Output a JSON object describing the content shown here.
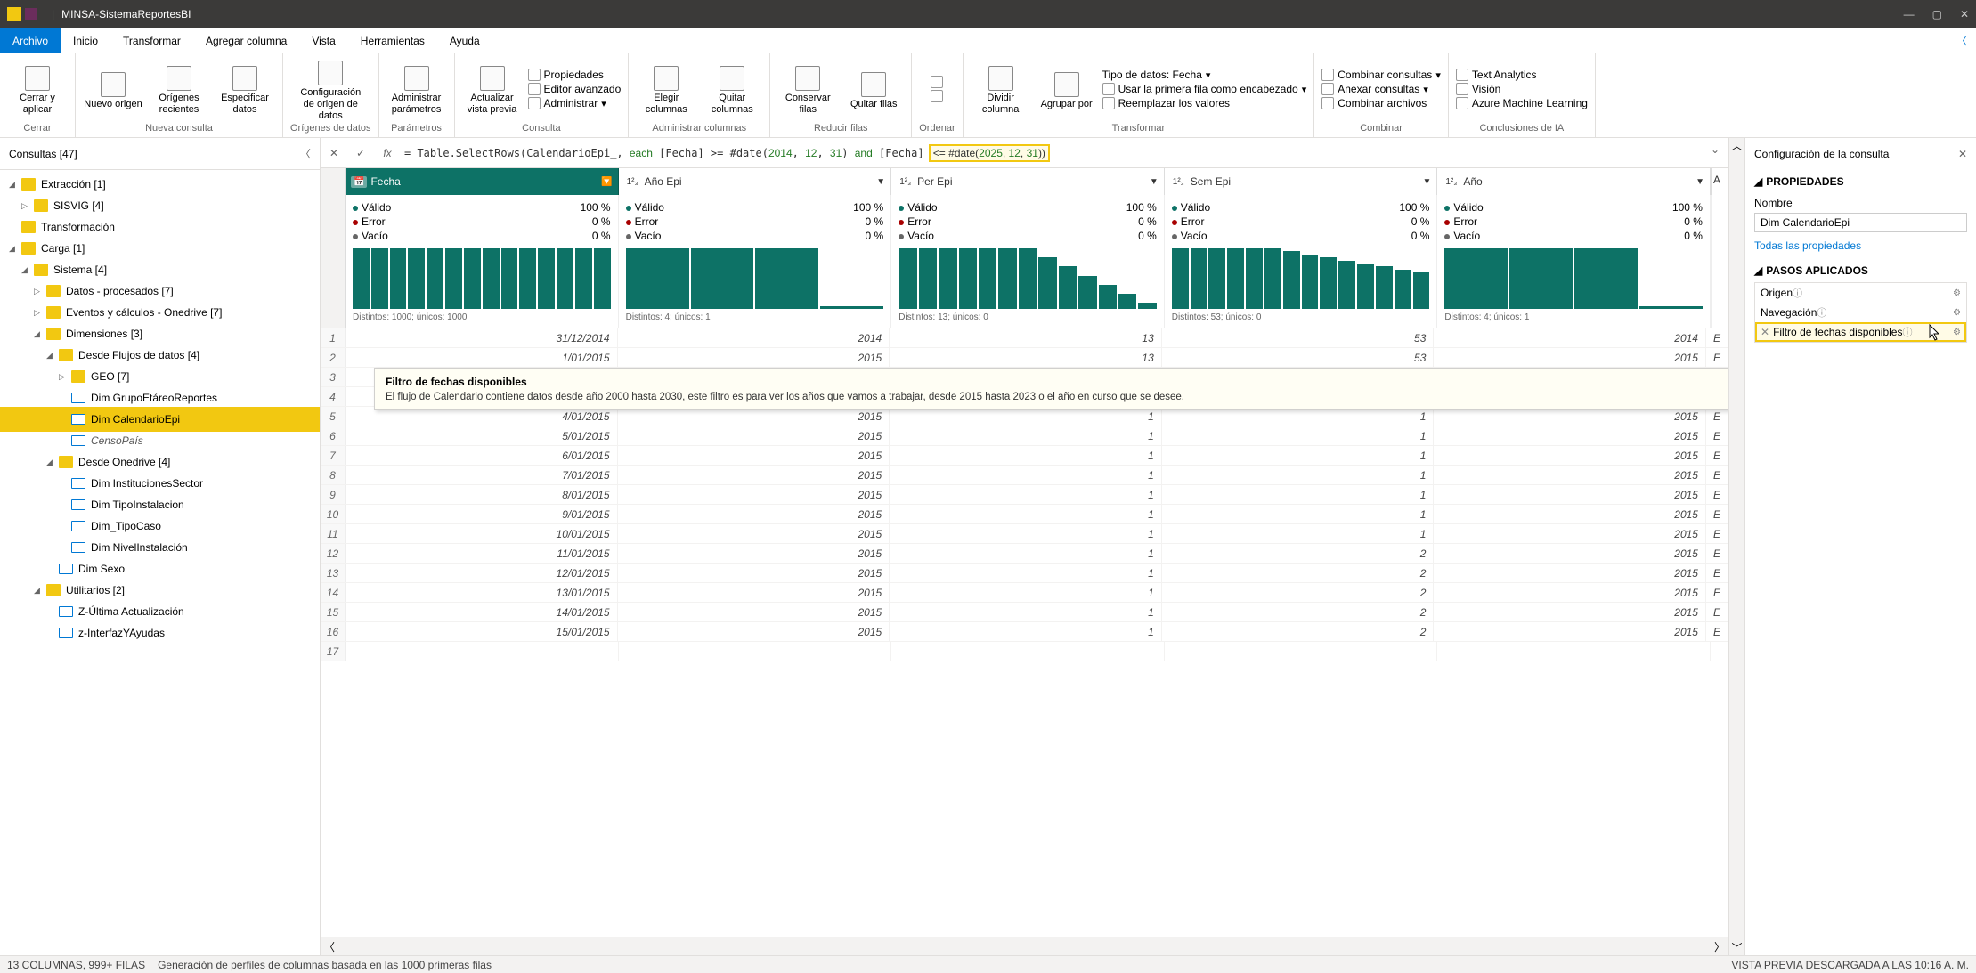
{
  "title": "MINSA-SistemaReportesBI",
  "tabs": [
    "Archivo",
    "Inicio",
    "Transformar",
    "Agregar columna",
    "Vista",
    "Herramientas",
    "Ayuda"
  ],
  "ribbon": {
    "close": {
      "label": "Cerrar y aplicar",
      "group": "Cerrar"
    },
    "nq": {
      "new": "Nuevo origen",
      "recent": "Orígenes recientes",
      "spec": "Especificar datos",
      "group": "Nueva consulta"
    },
    "ds": {
      "config": "Configuración de origen de datos",
      "group": "Orígenes de datos"
    },
    "params": {
      "manage": "Administrar parámetros",
      "group": "Parámetros"
    },
    "query": {
      "refresh": "Actualizar vista previa",
      "props": "Propiedades",
      "adv": "Editor avanzado",
      "admin": "Administrar",
      "group": "Consulta"
    },
    "cols": {
      "choose": "Elegir columnas",
      "remove": "Quitar columnas",
      "group": "Administrar columnas"
    },
    "rows": {
      "keep": "Conservar filas",
      "remove": "Quitar filas",
      "group": "Reducir filas"
    },
    "sort": {
      "group": "Ordenar"
    },
    "transform": {
      "split": "Dividir columna",
      "group_by": "Agrupar por",
      "datatype": "Tipo de datos: Fecha",
      "first_row": "Usar la primera fila como encabezado",
      "replace": "Reemplazar los valores",
      "group": "Transformar"
    },
    "combine": {
      "merge": "Combinar consultas",
      "append": "Anexar consultas",
      "combine_files": "Combinar archivos",
      "group": "Combinar"
    },
    "ia": {
      "text": "Text Analytics",
      "vision": "Visión",
      "aml": "Azure Machine Learning",
      "group": "Conclusiones de IA"
    }
  },
  "queries_title": "Consultas [47]",
  "tree": {
    "extraccion": "Extracción [1]",
    "sisvig": "SISVIG [4]",
    "transformacion": "Transformación",
    "carga": "Carga [1]",
    "sistema": "Sistema [4]",
    "datos": "Datos - procesados [7]",
    "eventos": "Eventos y cálculos - Onedrive [7]",
    "dimensiones": "Dimensiones [3]",
    "flujos": "Desde Flujos de datos [4]",
    "geo": "GEO [7]",
    "grupo": "Dim GrupoEtáreoReportes",
    "calendario": "Dim CalendarioEpi",
    "censo": "CensoPaís",
    "onedrive": "Desde Onedrive [4]",
    "inst": "Dim InstitucionesSector",
    "tipo": "Dim TipoInstalacion",
    "tipocaso": "Dim_TipoCaso",
    "nivel": "Dim NivelInstalación",
    "sexo": "Dim Sexo",
    "util": "Utilitarios [2]",
    "zult": "Z-Última Actualización",
    "zint": "z-InterfazYAyudas"
  },
  "formula": "= Table.SelectRows(CalendarioEpi_, each [Fecha] >= #date(2014, 12, 31) and [Fecha] <= #date(2025, 12, 31))",
  "columns": [
    {
      "name": "Fecha",
      "type": "date",
      "filter": true
    },
    {
      "name": "Año Epi",
      "type": "int"
    },
    {
      "name": "Per Epi",
      "type": "int"
    },
    {
      "name": "Sem Epi",
      "type": "int"
    },
    {
      "name": "Año",
      "type": "int"
    }
  ],
  "profile_stats": [
    {
      "valid": "100 %",
      "error": "0 %",
      "empty": "0 %",
      "distinct": "Distintos: 1000; únicos: 1000"
    },
    {
      "valid": "100 %",
      "error": "0 %",
      "empty": "0 %",
      "distinct": "Distintos: 4; únicos: 1"
    },
    {
      "valid": "100 %",
      "error": "0 %",
      "empty": "0 %",
      "distinct": "Distintos: 13; únicos: 0"
    },
    {
      "valid": "100 %",
      "error": "0 %",
      "empty": "0 %",
      "distinct": "Distintos: 53; únicos: 0"
    },
    {
      "valid": "100 %",
      "error": "0 %",
      "empty": "0 %",
      "distinct": "Distintos: 4; únicos: 1"
    }
  ],
  "profile_labels": {
    "valid": "Válido",
    "error": "Error",
    "empty": "Vacío"
  },
  "chart_data": {
    "type": "bar",
    "note": "Column distribution histograms (relative heights, 0-100%)",
    "series": [
      {
        "name": "Fecha",
        "values": [
          100,
          100,
          100,
          100,
          100,
          100,
          100,
          100,
          100,
          100,
          100,
          100,
          100,
          100
        ]
      },
      {
        "name": "Año Epi",
        "values": [
          100,
          100,
          100,
          5
        ]
      },
      {
        "name": "Per Epi",
        "values": [
          100,
          100,
          100,
          100,
          100,
          100,
          100,
          85,
          70,
          55,
          40,
          25,
          10
        ]
      },
      {
        "name": "Sem Epi",
        "values": [
          100,
          100,
          100,
          100,
          100,
          100,
          95,
          90,
          85,
          80,
          75,
          70,
          65,
          60
        ]
      },
      {
        "name": "Año",
        "values": [
          100,
          100,
          100,
          5
        ]
      }
    ]
  },
  "rows": [
    {
      "n": 1,
      "fecha": "31/12/2014",
      "anoepi": "2014",
      "per": "13",
      "sem": "53",
      "ano": "2014",
      "t": "E"
    },
    {
      "n": 2,
      "fecha": "1/01/2015",
      "anoepi": "2015",
      "per": "13",
      "sem": "53",
      "ano": "2015",
      "t": "E"
    },
    {
      "n": 3,
      "fecha": "",
      "anoepi": "",
      "per": "",
      "sem": "",
      "ano": "",
      "t": ""
    },
    {
      "n": 4,
      "fecha": "",
      "anoepi": "",
      "per": "",
      "sem": "",
      "ano": "",
      "t": ""
    },
    {
      "n": 5,
      "fecha": "4/01/2015",
      "anoepi": "2015",
      "per": "1",
      "sem": "1",
      "ano": "2015",
      "t": "E"
    },
    {
      "n": 6,
      "fecha": "5/01/2015",
      "anoepi": "2015",
      "per": "1",
      "sem": "1",
      "ano": "2015",
      "t": "E"
    },
    {
      "n": 7,
      "fecha": "6/01/2015",
      "anoepi": "2015",
      "per": "1",
      "sem": "1",
      "ano": "2015",
      "t": "E"
    },
    {
      "n": 8,
      "fecha": "7/01/2015",
      "anoepi": "2015",
      "per": "1",
      "sem": "1",
      "ano": "2015",
      "t": "E"
    },
    {
      "n": 9,
      "fecha": "8/01/2015",
      "anoepi": "2015",
      "per": "1",
      "sem": "1",
      "ano": "2015",
      "t": "E"
    },
    {
      "n": 10,
      "fecha": "9/01/2015",
      "anoepi": "2015",
      "per": "1",
      "sem": "1",
      "ano": "2015",
      "t": "E"
    },
    {
      "n": 11,
      "fecha": "10/01/2015",
      "anoepi": "2015",
      "per": "1",
      "sem": "1",
      "ano": "2015",
      "t": "E"
    },
    {
      "n": 12,
      "fecha": "11/01/2015",
      "anoepi": "2015",
      "per": "1",
      "sem": "2",
      "ano": "2015",
      "t": "E"
    },
    {
      "n": 13,
      "fecha": "12/01/2015",
      "anoepi": "2015",
      "per": "1",
      "sem": "2",
      "ano": "2015",
      "t": "E"
    },
    {
      "n": 14,
      "fecha": "13/01/2015",
      "anoepi": "2015",
      "per": "1",
      "sem": "2",
      "ano": "2015",
      "t": "E"
    },
    {
      "n": 15,
      "fecha": "14/01/2015",
      "anoepi": "2015",
      "per": "1",
      "sem": "2",
      "ano": "2015",
      "t": "E"
    },
    {
      "n": 16,
      "fecha": "15/01/2015",
      "anoepi": "2015",
      "per": "1",
      "sem": "2",
      "ano": "2015",
      "t": "E"
    },
    {
      "n": 17,
      "fecha": "",
      "anoepi": "",
      "per": "",
      "sem": "",
      "ano": "",
      "t": ""
    }
  ],
  "tooltip": {
    "title": "Filtro de fechas disponibles",
    "body": "El flujo de Calendario contiene datos desde año 2000 hasta 2030, este filtro es para ver los años que vamos a trabajar, desde 2015 hasta 2023 o el año en curso que se desee."
  },
  "props": {
    "header": "Configuración de la consulta",
    "properties": "PROPIEDADES",
    "name_label": "Nombre",
    "name_value": "Dim CalendarioEpi",
    "all_props": "Todas las propiedades",
    "steps_title": "PASOS APLICADOS",
    "steps": [
      "Origen",
      "Navegación",
      "Filtro de fechas disponibles"
    ]
  },
  "status": {
    "left": "13 COLUMNAS, 999+ FILAS",
    "mid": "Generación de perfiles de columnas basada en las 1000 primeras filas",
    "right": "VISTA PREVIA DESCARGADA A LAS 10:16 A. M."
  }
}
